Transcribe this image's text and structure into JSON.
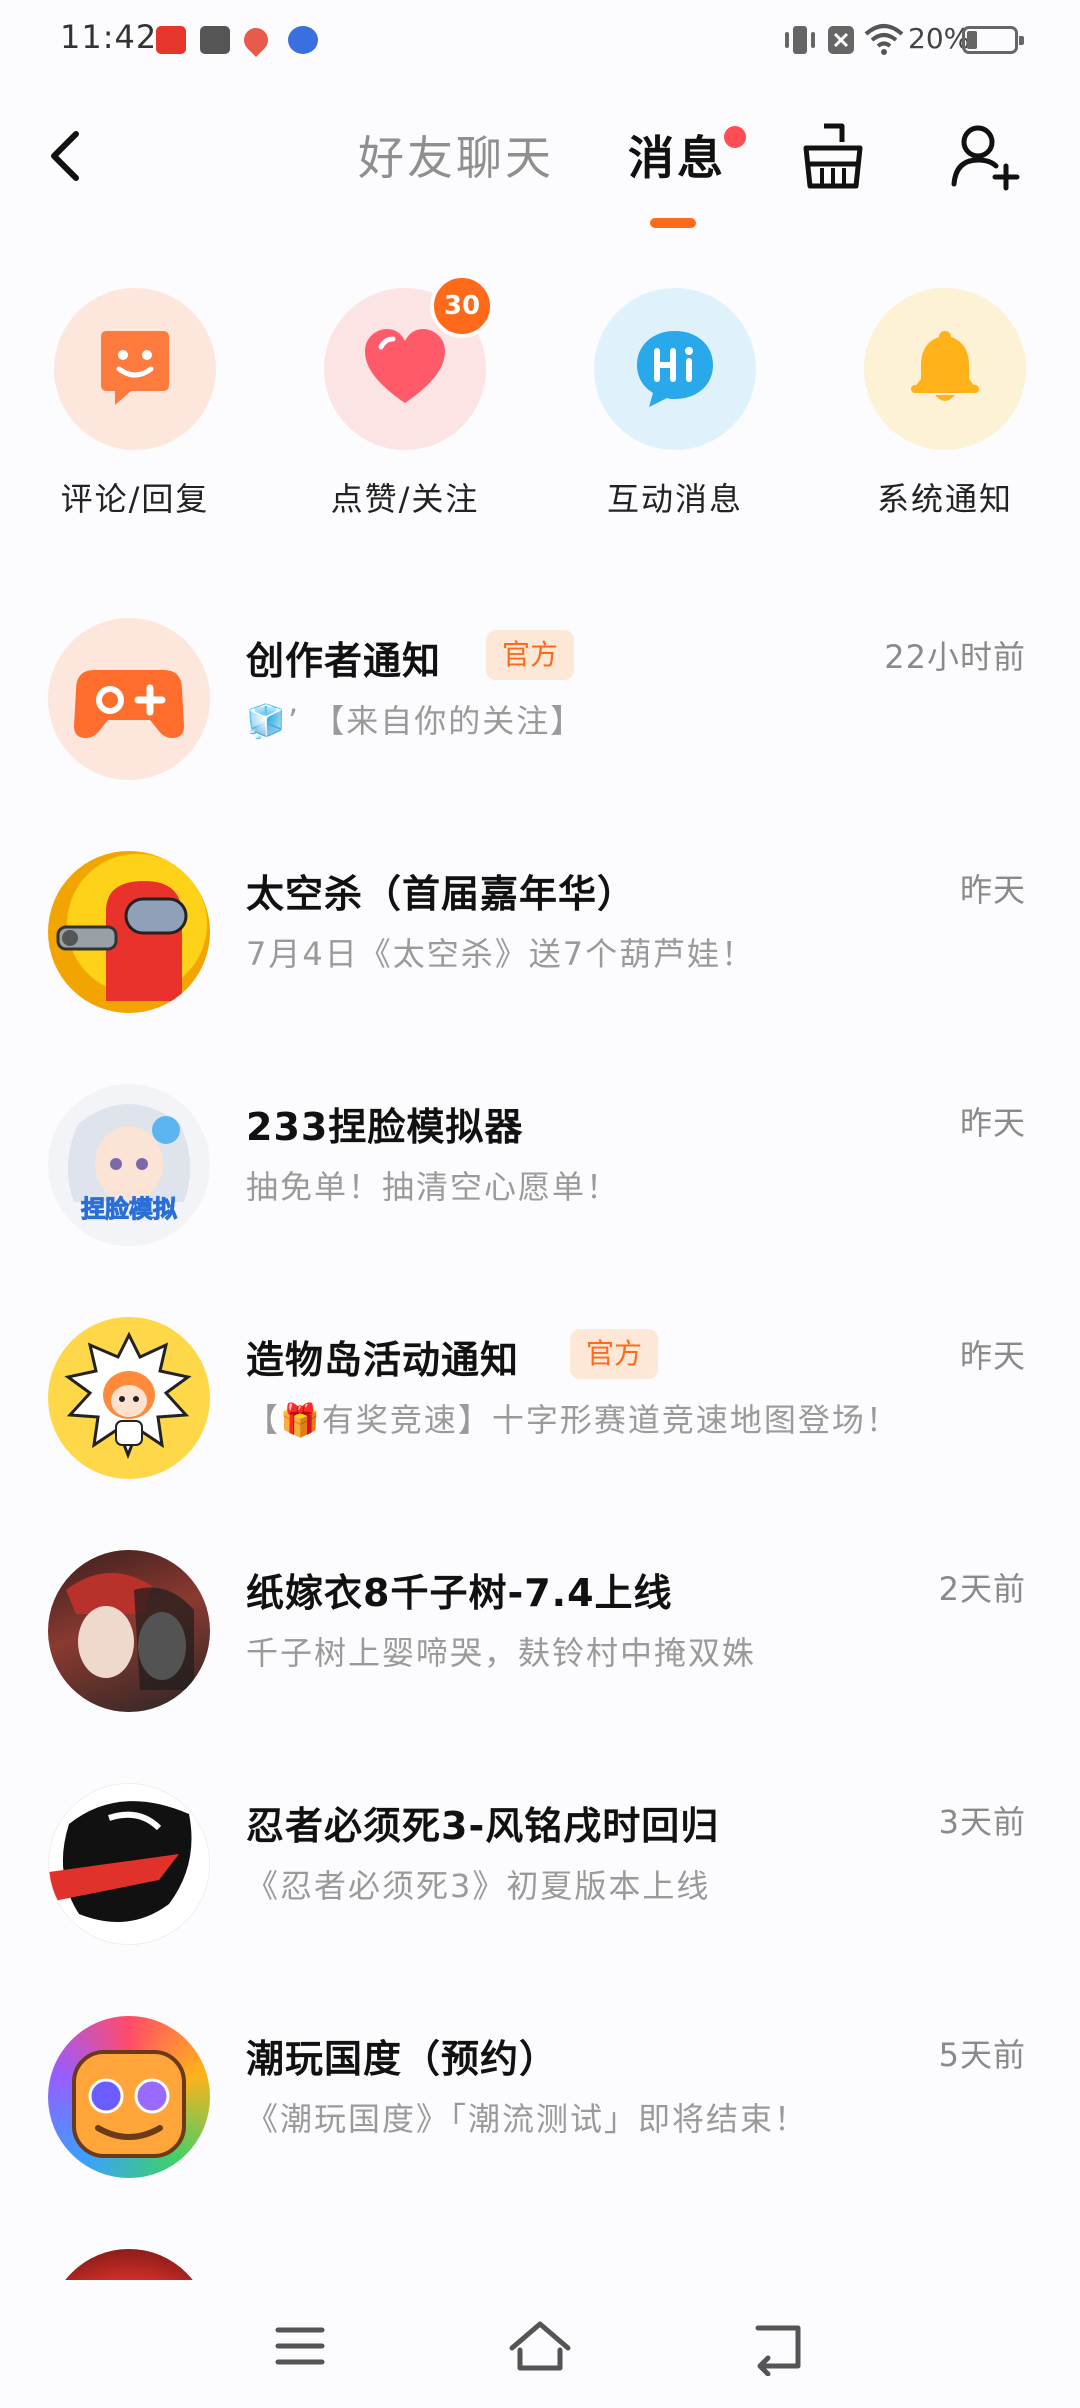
{
  "status_bar": {
    "time": "11:42",
    "icons": [
      "toutiao-icon",
      "book-icon",
      "map-pin-icon",
      "baidu-icon"
    ],
    "right_icons": [
      "vibrate-icon",
      "no-sim-icon",
      "wifi-icon"
    ],
    "battery": "20%"
  },
  "header": {
    "back_icon": "chevron-left-icon",
    "tabs": [
      {
        "label": "好友聊天",
        "active": false
      },
      {
        "label": "消息",
        "active": true,
        "has_dot": true
      }
    ],
    "clean_icon": "broom-icon",
    "add_friend_icon": "add-user-icon"
  },
  "categories": [
    {
      "label": "评论/回复",
      "icon": "comment-smile-icon",
      "bg": "#fde7dc",
      "color": "#ff7a3d"
    },
    {
      "label": "点赞/关注",
      "icon": "heart-icon",
      "bg": "#fde4e4",
      "color": "#ff5a6a",
      "badge": "30"
    },
    {
      "label": "互动消息",
      "icon": "hi-chat-icon",
      "bg": "#dff2fc",
      "color": "#29a8ea"
    },
    {
      "label": "系统通知",
      "icon": "bell-icon",
      "bg": "#fdf1d6",
      "color": "#ffb21a"
    }
  ],
  "messages": [
    {
      "title": "创作者通知",
      "official": "官方",
      "subtitle": "🧊’ 【来自你的关注】",
      "time": "22小时前",
      "avatar": "gamepad-plus-icon"
    },
    {
      "title": "太空杀（首届嘉年华）",
      "subtitle": "7月4日《太空杀》送7个葫芦娃！",
      "time": "昨天",
      "avatar": "space-kill-avatar"
    },
    {
      "title": "233捏脸模拟器",
      "subtitle": "抽免单！抽清空心愿单！",
      "time": "昨天",
      "avatar": "face-sim-avatar",
      "avatar_text": "捏脸模拟"
    },
    {
      "title": "造物岛活动通知",
      "official": "官方",
      "subtitle": "【🎁有奖竞速】十字形赛道竞速地图登场！",
      "time": "昨天",
      "avatar": "creation-island-avatar"
    },
    {
      "title": "纸嫁衣8千子树-7.4上线",
      "subtitle": "千子树上婴啼哭，麸铃村中掩双姝",
      "time": "2天前",
      "avatar": "paper-bride-avatar"
    },
    {
      "title": "忍者必须死3-风铭戌时回归",
      "subtitle": "《忍者必须死3》初夏版本上线",
      "time": "3天前",
      "avatar": "ninja-avatar"
    },
    {
      "title": "潮玩国度（预约）",
      "subtitle": "《潮玩国度》「潮流测试」即将结束！",
      "time": "5天前",
      "avatar": "trendy-kingdom-avatar"
    }
  ],
  "nav": {
    "menu_icon": "menu-icon",
    "home_icon": "home-icon",
    "back_icon": "back-arrow-icon"
  }
}
